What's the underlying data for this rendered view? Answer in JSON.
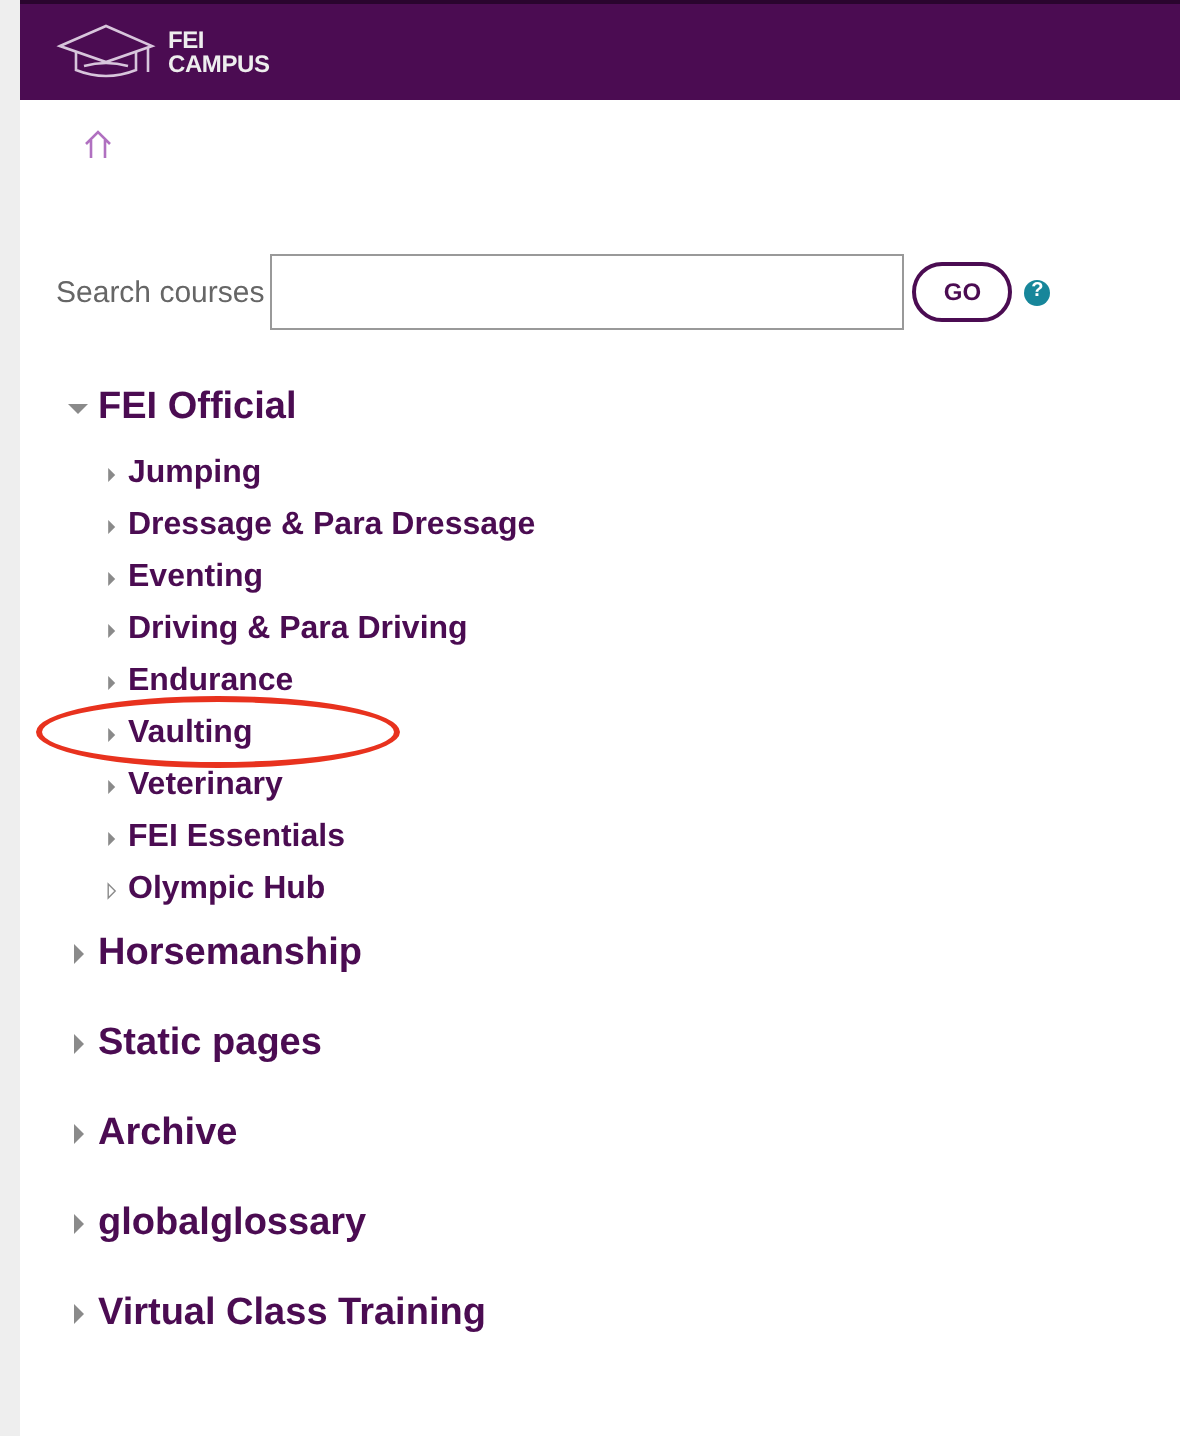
{
  "header": {
    "logo_lines": [
      "FEI",
      "CAMPUS"
    ]
  },
  "search": {
    "label": "Search courses",
    "button": "GO",
    "help": "?"
  },
  "categories": [
    {
      "label": "FEI Official",
      "expanded": true,
      "highlighted": false,
      "has_children": true,
      "children": [
        {
          "label": "Jumping",
          "expanded": false,
          "highlighted": false,
          "has_children": true
        },
        {
          "label": "Dressage & Para Dressage",
          "expanded": false,
          "highlighted": false,
          "has_children": true
        },
        {
          "label": "Eventing",
          "expanded": false,
          "highlighted": false,
          "has_children": true
        },
        {
          "label": "Driving & Para Driving",
          "expanded": false,
          "highlighted": false,
          "has_children": true
        },
        {
          "label": "Endurance",
          "expanded": false,
          "highlighted": false,
          "has_children": true
        },
        {
          "label": "Vaulting",
          "expanded": false,
          "highlighted": true,
          "has_children": true
        },
        {
          "label": "Veterinary",
          "expanded": false,
          "highlighted": false,
          "has_children": true
        },
        {
          "label": "FEI Essentials",
          "expanded": false,
          "highlighted": false,
          "has_children": true
        },
        {
          "label": "Olympic Hub",
          "expanded": false,
          "highlighted": false,
          "has_children": false
        }
      ]
    },
    {
      "label": "Horsemanship",
      "expanded": false,
      "highlighted": false,
      "has_children": true
    },
    {
      "label": "Static pages",
      "expanded": false,
      "highlighted": false,
      "has_children": true
    },
    {
      "label": "Archive",
      "expanded": false,
      "highlighted": false,
      "has_children": true
    },
    {
      "label": "globalglossary",
      "expanded": false,
      "highlighted": false,
      "has_children": true
    },
    {
      "label": "Virtual Class Training",
      "expanded": false,
      "highlighted": false,
      "has_children": true
    }
  ]
}
